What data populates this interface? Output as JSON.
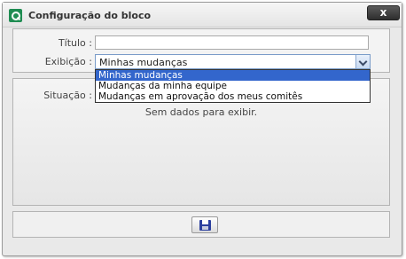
{
  "dialog": {
    "title": "Configuração do bloco",
    "close_label": "x"
  },
  "form": {
    "titulo_label": "Título :",
    "titulo_value": "",
    "exibicao_label": "Exibição :",
    "exibicao_selected": "Minhas mudanças",
    "exibicao_options": [
      "Minhas mudanças",
      "Mudanças da minha equipe",
      "Mudanças em aprovação dos meus comitês"
    ]
  },
  "info": {
    "situacao_label": "Situação :",
    "empty_message": "Sem dados para exibir."
  },
  "actions": {
    "save_icon": "floppy-disk-icon"
  },
  "colors": {
    "accent_green": "#1f8c52",
    "selected_option_bg": "#3366cc",
    "close_button_bg": "#3a3a3a"
  }
}
